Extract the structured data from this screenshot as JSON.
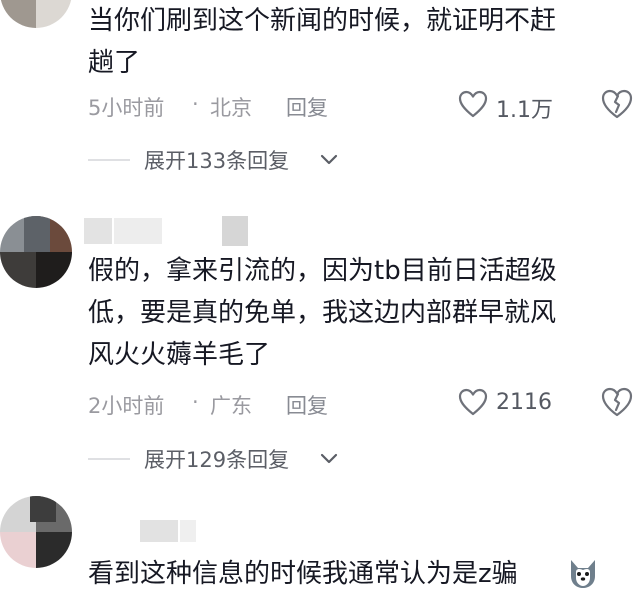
{
  "comments": [
    {
      "text_lines": [
        "当你们刷到这个新闻的时候，就证明不赶",
        "趟了"
      ],
      "time": "5小时前",
      "location": "北京",
      "reply_label": "回复",
      "likes": "1.1万",
      "expand_label": "展开133条回复"
    },
    {
      "text_lines": [
        "假的，拿来引流的，因为tb目前日活超级",
        "低，要是真的免单，我这边内部群早就风",
        "风火火薅羊毛了"
      ],
      "time": "2小时前",
      "location": "广东",
      "reply_label": "回复",
      "likes": "2116",
      "expand_label": "展开129条回复"
    },
    {
      "text_lines": [
        "看到这种信息的时候我通常认为是z骗"
      ]
    }
  ],
  "meta_separator": "·",
  "icons": {
    "like": "heart-outline-icon",
    "dislike": "broken-heart-icon",
    "expand": "chevron-down-icon",
    "emoji": "husky-dog-emoji-icon"
  },
  "colors": {
    "text": "#161823",
    "meta": "#9a9aa0",
    "divider": "#dfe0e3"
  }
}
